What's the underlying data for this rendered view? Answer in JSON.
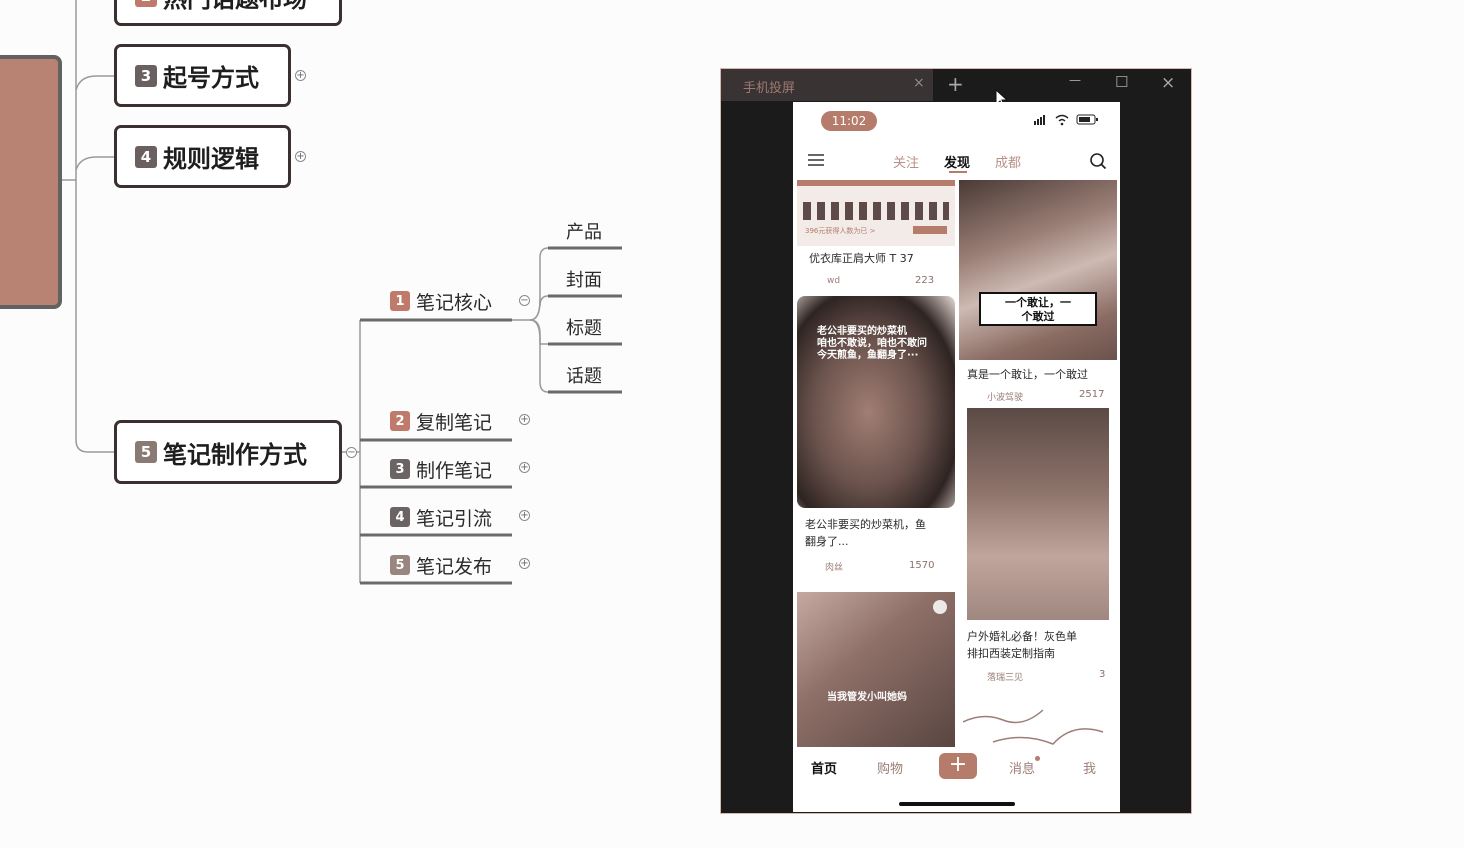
{
  "mindmap": {
    "partial_top_node": "热门话题布场",
    "nodes": [
      {
        "num": "3",
        "label": "起号方式"
      },
      {
        "num": "4",
        "label": "规则逻辑"
      },
      {
        "num": "5",
        "label": "笔记制作方式"
      }
    ],
    "subs": [
      {
        "num": "1",
        "label": "笔记核心"
      },
      {
        "num": "2",
        "label": "复制笔记"
      },
      {
        "num": "3",
        "label": "制作笔记"
      },
      {
        "num": "4",
        "label": "笔记引流"
      },
      {
        "num": "5",
        "label": "笔记发布"
      }
    ],
    "leaves": [
      "产品",
      "封面",
      "标题",
      "话题"
    ]
  },
  "window": {
    "tab_title": "手机投屏",
    "tab_close": "×",
    "new_tab": "+",
    "minimize": "—",
    "maximize": "☐",
    "close": "×"
  },
  "phone": {
    "time": "11:02",
    "nav_tabs": [
      "关注",
      "发现",
      "成都"
    ],
    "active_tab": "发现",
    "cards": [
      {
        "title": "优衣库正肩大师 T 37",
        "author": "wd",
        "likes": "223",
        "banner_small": "396元获得人数为已 >"
      },
      {
        "title": "真是一个敢让，一个敢过",
        "author": "小波驾驶",
        "likes": "2517",
        "overlay": "一个敢让，一\n个敢过"
      },
      {
        "title": "老公非要买的炒菜机，鱼\n翻身了...",
        "author": "肉丝",
        "likes": "1570",
        "overlay": "老公非要买的炒菜机\n咱也不敢说，咱也不敢问\n今天煎鱼，鱼翻身了···"
      },
      {
        "title": "户外婚礼必备！灰色单\n排扣西装定制指南",
        "author": "落瑞三见",
        "likes": "3"
      },
      {
        "title": "",
        "overlay": "当我管发小叫她妈"
      }
    ],
    "tabbar": [
      "首页",
      "购物",
      "+",
      "消息",
      "我"
    ]
  },
  "colors": {
    "accent": "#b57b6b",
    "node_border": "#3a3030",
    "sub_red": "#c07a6c"
  }
}
